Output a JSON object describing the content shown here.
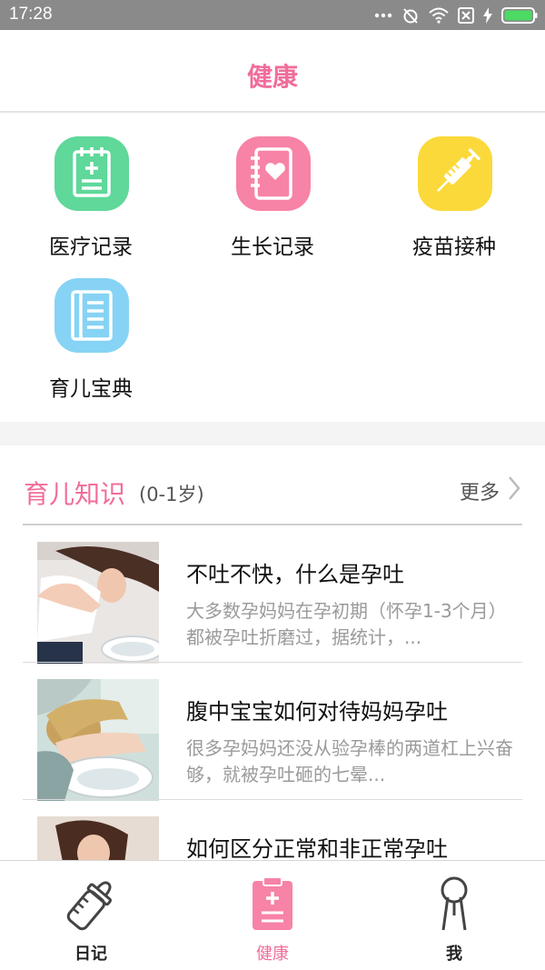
{
  "status_bar": {
    "time": "17:28"
  },
  "header": {
    "title": "健康"
  },
  "tools": [
    {
      "label": "医疗记录",
      "icon": "medical-record-icon",
      "color": "#5fd89a"
    },
    {
      "label": "生长记录",
      "icon": "growth-record-icon",
      "color": "#f783a6"
    },
    {
      "label": "疫苗接种",
      "icon": "vaccine-syringe-icon",
      "color": "#fbd93a"
    },
    {
      "label": "育儿宝典",
      "icon": "parenting-book-icon",
      "color": "#86d3f5"
    }
  ],
  "section": {
    "title": "育儿知识",
    "subtitle": "(0-1岁)",
    "more_label": "更多"
  },
  "articles": [
    {
      "title": "不吐不快，什么是孕吐",
      "desc": "大多数孕妈妈在孕初期（怀孕1-3个月）都被孕吐折磨过，据统计，..."
    },
    {
      "title": "腹中宝宝如何对待妈妈孕吐",
      "desc": "很多孕妈妈还没从验孕棒的两道杠上兴奋够，就被孕吐砸的七晕..."
    },
    {
      "title": "如何区分正常和非正常孕吐",
      "desc": ""
    }
  ],
  "tabbar": [
    {
      "label": "日记",
      "icon": "baby-bottle-icon"
    },
    {
      "label": "健康",
      "icon": "health-clipboard-icon",
      "active": true
    },
    {
      "label": "我",
      "icon": "person-icon"
    }
  ],
  "colors": {
    "accent": "#f06d9b",
    "status_bar_bg": "#8a8a8a"
  }
}
